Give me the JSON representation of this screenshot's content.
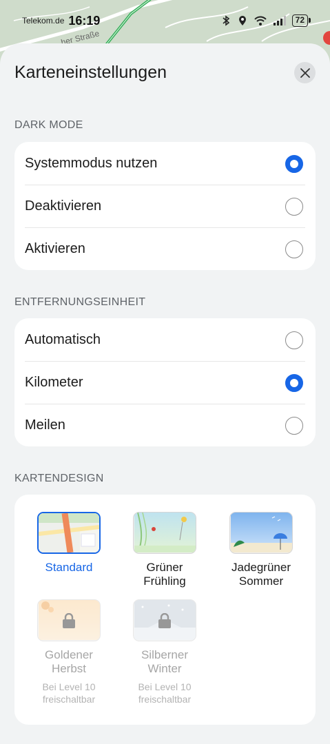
{
  "status_bar": {
    "carrier": "Telekom.de",
    "time": "16:19",
    "battery": "72"
  },
  "map": {
    "street_fragment": "her Straße"
  },
  "sheet": {
    "title": "Karteneinstellungen",
    "close_icon": "close-icon"
  },
  "dark_mode": {
    "label": "DARK MODE",
    "options": [
      {
        "label": "Systemmodus nutzen",
        "selected": true
      },
      {
        "label": "Deaktivieren",
        "selected": false
      },
      {
        "label": "Aktivieren",
        "selected": false
      }
    ]
  },
  "distance_unit": {
    "label": "ENTFERNUNGSEINHEIT",
    "options": [
      {
        "label": "Automatisch",
        "selected": false
      },
      {
        "label": "Kilometer",
        "selected": true
      },
      {
        "label": "Meilen",
        "selected": false
      }
    ]
  },
  "map_design": {
    "label": "KARTENDESIGN",
    "themes": [
      {
        "label": "Standard",
        "selected": true,
        "locked": false
      },
      {
        "label_line1": "Grüner",
        "label_line2": "Frühling",
        "selected": false,
        "locked": false
      },
      {
        "label_line1": "Jadegrüner",
        "label_line2": "Sommer",
        "selected": false,
        "locked": false
      },
      {
        "label_line1": "Goldener",
        "label_line2": "Herbst",
        "sub_line1": "Bei Level 10",
        "sub_line2": "freischaltbar",
        "selected": false,
        "locked": true
      },
      {
        "label_line1": "Silberner",
        "label_line2": "Winter",
        "sub_line1": "Bei Level 10",
        "sub_line2": "freischaltbar",
        "selected": false,
        "locked": true
      }
    ]
  },
  "colors": {
    "accent": "#1766e6",
    "sheet_bg": "#f1f3f4",
    "card_bg": "#ffffff",
    "section_text": "#5f6368"
  }
}
